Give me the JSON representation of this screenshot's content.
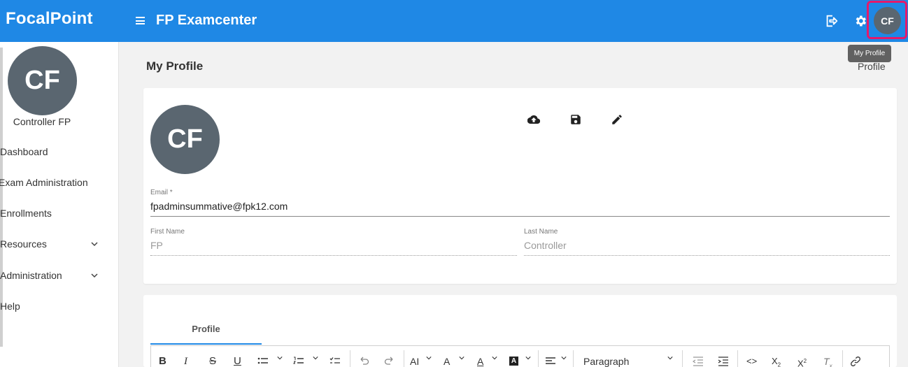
{
  "header": {
    "brand": "FocalPoint",
    "app_title": "FP Examcenter",
    "avatar_initials": "CF",
    "tooltip": "My Profile"
  },
  "sidebar": {
    "avatar_initials": "CF",
    "user_name": "Controller FP",
    "items": [
      {
        "label": "Dashboard"
      },
      {
        "label": "Exam Administration"
      },
      {
        "label": "Enrollments"
      },
      {
        "label": "Resources",
        "expandable": true
      },
      {
        "label": "Administration",
        "expandable": true
      },
      {
        "label": "Help"
      }
    ]
  },
  "main": {
    "page_title": "My Profile",
    "breadcrumb": "Profile",
    "profile": {
      "avatar_initials": "CF",
      "email_label": "Email *",
      "email_value": "fpadminsummative@fpk12.com",
      "first_name_label": "First Name",
      "first_name_value": "FP",
      "last_name_label": "Last Name",
      "last_name_value": "Controller"
    },
    "tabs": [
      {
        "label": "Profile"
      }
    ],
    "editor": {
      "paragraph_select": "Paragraph"
    }
  },
  "colors": {
    "header_bg": "#1f88e5",
    "avatar_bg": "#5a6670",
    "highlight": "#e5196b"
  }
}
